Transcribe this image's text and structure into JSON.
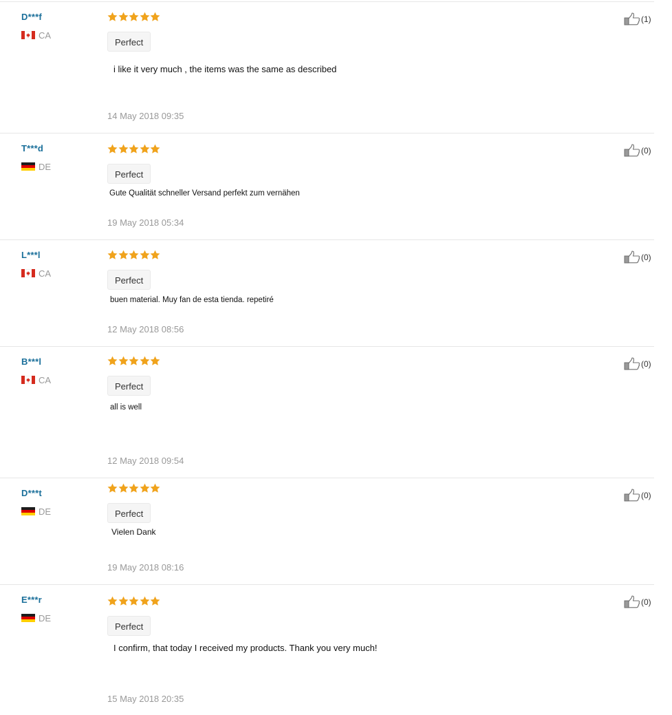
{
  "colors": {
    "username": "#1a6f9a",
    "star": "#f0a31c",
    "muted": "#999999",
    "divider": "#e6e6e6",
    "tag_bg": "#f5f5f5"
  },
  "reviews": [
    {
      "user": "D***f",
      "country": "CA",
      "flag": "canada-flag-icon",
      "stars": 5,
      "tag": "Perfect",
      "text": "i like it very much , the items was the same as described",
      "date": "14 May 2018 09:35",
      "helpful": "(1)"
    },
    {
      "user": "T***d",
      "country": "DE",
      "flag": "germany-flag-icon",
      "stars": 5,
      "tag": "Perfect",
      "text": "Gute Qualität schneller Versand perfekt zum vernähen",
      "date": "19 May 2018 05:34",
      "helpful": "(0)"
    },
    {
      "user": "L***l",
      "country": "CA",
      "flag": "canada-flag-icon",
      "stars": 5,
      "tag": "Perfect",
      "text": "buen material. Muy fan de esta tienda. repetiré",
      "date": "12 May 2018 08:56",
      "helpful": "(0)"
    },
    {
      "user": "B***l",
      "country": "CA",
      "flag": "canada-flag-icon",
      "stars": 5,
      "tag": "Perfect",
      "text": "all is well",
      "date": "12 May 2018 09:54",
      "helpful": "(0)"
    },
    {
      "user": "D***t",
      "country": "DE",
      "flag": "germany-flag-icon",
      "stars": 5,
      "tag": "Perfect",
      "text": "Vielen Dank",
      "date": "19 May 2018 08:16",
      "helpful": "(0)"
    },
    {
      "user": "E***r",
      "country": "DE",
      "flag": "germany-flag-icon",
      "stars": 5,
      "tag": "Perfect",
      "text": "I confirm, that today I received my products. Thank you very much!",
      "date": "15 May 2018 20:35",
      "helpful": "(0)"
    }
  ]
}
